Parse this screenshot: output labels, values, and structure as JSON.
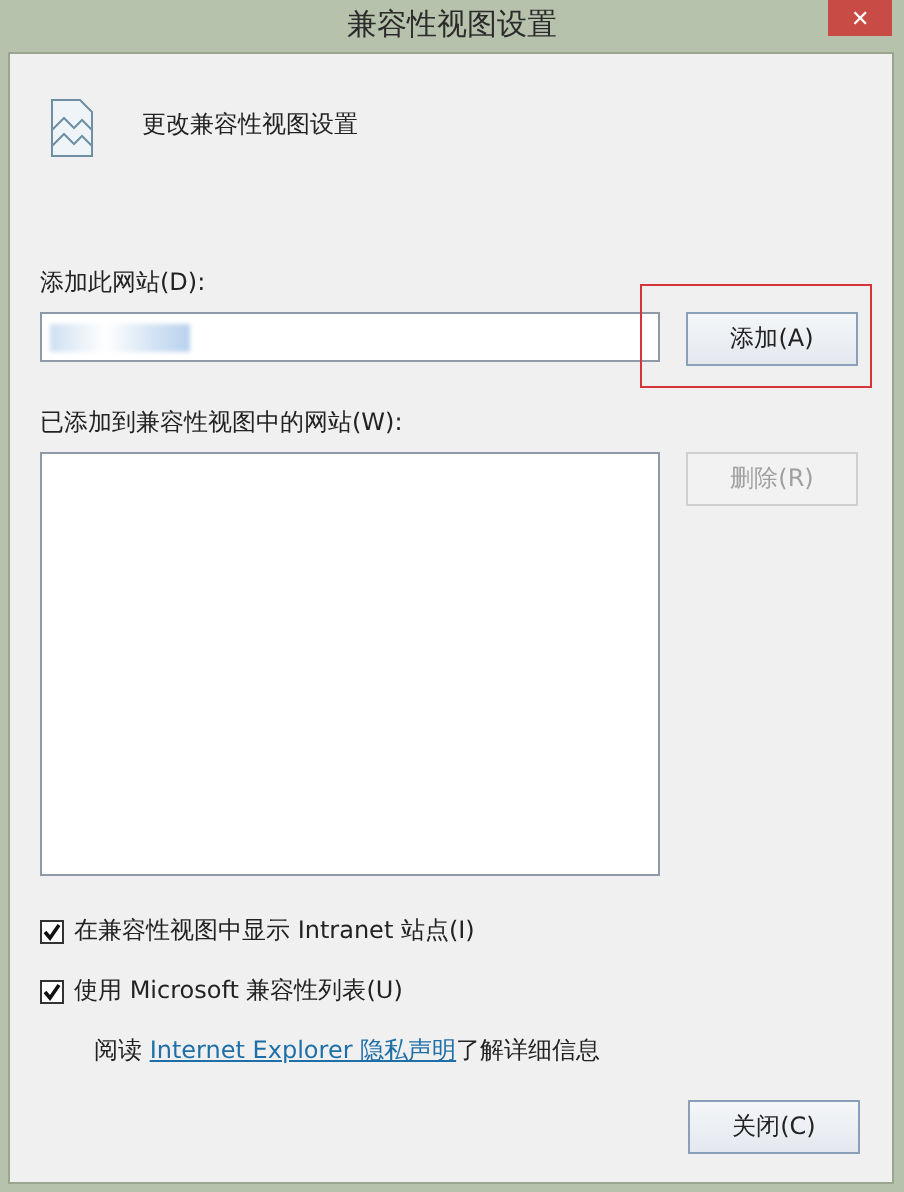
{
  "window": {
    "title": "兼容性视图设置",
    "close_glyph": "✕"
  },
  "heading": "更改兼容性视图设置",
  "add_site": {
    "label": "添加此网站(D):",
    "value_redacted": true
  },
  "add_button": {
    "label": "添加(A)",
    "disabled": false,
    "highlighted": true
  },
  "list_label": "已添加到兼容性视图中的网站(W):",
  "remove_button": {
    "label": "删除(R)",
    "disabled": true
  },
  "options": [
    {
      "label": "在兼容性视图中显示 Intranet 站点(I)",
      "checked": true
    },
    {
      "label": "使用 Microsoft 兼容性列表(U)",
      "checked": true
    }
  ],
  "privacy": {
    "before": "阅读 ",
    "link": "Internet Explorer 隐私声明",
    "after": "了解详细信息"
  },
  "close_button": {
    "label": "关闭(C)",
    "disabled": false
  }
}
